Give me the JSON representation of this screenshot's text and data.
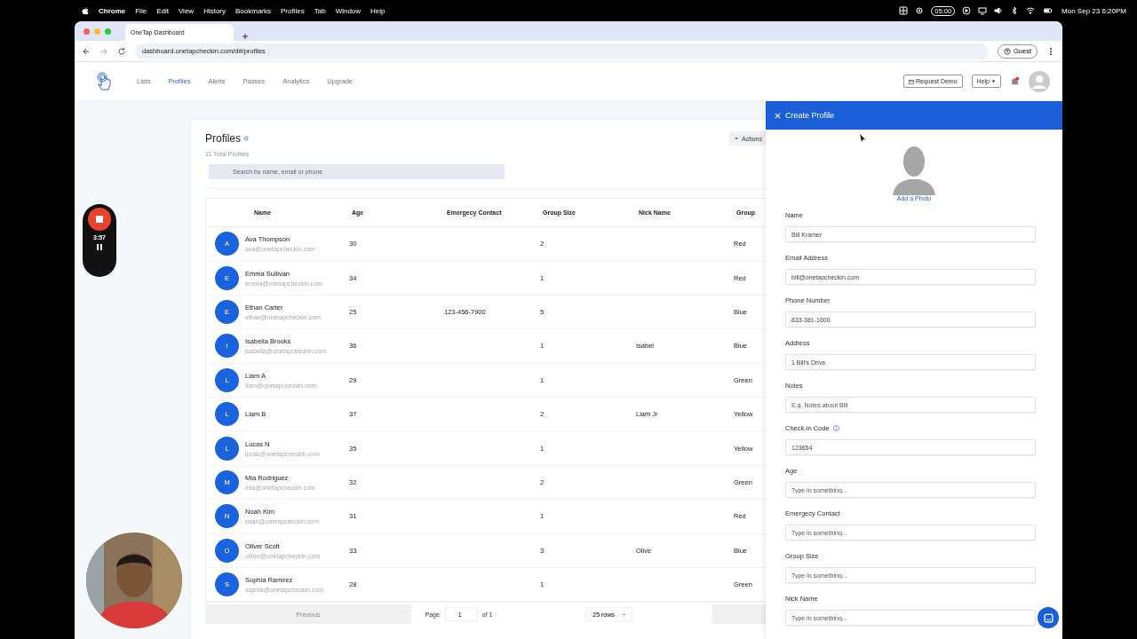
{
  "menu_bar": {
    "app": "Chrome",
    "menus": [
      "File",
      "Edit",
      "View",
      "History",
      "Bookmarks",
      "Profiles",
      "Tab",
      "Window",
      "Help"
    ],
    "timer": "05:00",
    "clock": "Mon Sep 23  6:20PM"
  },
  "browser": {
    "tab_title": "OneTap Dashboard",
    "url": "dashboard.onetapcheckin.com/d#/profiles",
    "profile_button": "Guest"
  },
  "nav": {
    "items": [
      {
        "label": "Lists",
        "selected": false
      },
      {
        "label": "Profiles",
        "selected": true
      },
      {
        "label": "Alerts",
        "selected": false
      },
      {
        "label": "Passes",
        "selected": false
      },
      {
        "label": "Analytics",
        "selected": false
      },
      {
        "label": "Upgrade",
        "selected": false
      }
    ],
    "request_demo": "Request Demo",
    "help": "Help"
  },
  "recorder": {
    "time": "3:57"
  },
  "profiles": {
    "title": "Profiles",
    "count": "11 Total Profiles",
    "search_placeholder": "Search by name, email or phone",
    "actions": "Actions",
    "columns": [
      "Name",
      "Age",
      "Emergecy Contact",
      "Group Size",
      "Nick Name",
      "Group"
    ],
    "rows": [
      {
        "initial": "A",
        "name": "Ava Thompson",
        "email": "ava@onetapcheckin.com",
        "age": "30",
        "emergency_contact": "",
        "group_size": "2",
        "nick_name": "",
        "group": "Red"
      },
      {
        "initial": "E",
        "name": "Emma Sullivan",
        "email": "emma@onetapcheckin.com",
        "age": "34",
        "emergency_contact": "",
        "group_size": "1",
        "nick_name": "",
        "group": "Red"
      },
      {
        "initial": "E",
        "name": "Ethan Carter",
        "email": "ethan@onetapcheckin.com",
        "age": "25",
        "emergency_contact": "123-456-7900",
        "group_size": "5",
        "nick_name": "",
        "group": "Blue"
      },
      {
        "initial": "I",
        "name": "Isabella Brooks",
        "email": "isabella@onetapcheckin.com",
        "age": "36",
        "emergency_contact": "",
        "group_size": "1",
        "nick_name": "Isabel",
        "group": "Blue"
      },
      {
        "initial": "L",
        "name": "Liam A",
        "email": "liam@onetapcheckin.com",
        "age": "29",
        "emergency_contact": "",
        "group_size": "1",
        "nick_name": "",
        "group": "Green"
      },
      {
        "initial": "L",
        "name": "Liam B",
        "email": "",
        "age": "37",
        "emergency_contact": "",
        "group_size": "2",
        "nick_name": "Liam Jr",
        "group": "Yellow"
      },
      {
        "initial": "L",
        "name": "Lucas N",
        "email": "lucas@onetapcheckin.com",
        "age": "35",
        "emergency_contact": "",
        "group_size": "1",
        "nick_name": "",
        "group": "Yellow"
      },
      {
        "initial": "M",
        "name": "Mia Rodriguez",
        "email": "mia@onetapcheckin.com",
        "age": "32",
        "emergency_contact": "",
        "group_size": "2",
        "nick_name": "",
        "group": "Green"
      },
      {
        "initial": "N",
        "name": "Noah Kim",
        "email": "noah@onetapcheckin.com",
        "age": "31",
        "emergency_contact": "",
        "group_size": "1",
        "nick_name": "",
        "group": "Red"
      },
      {
        "initial": "O",
        "name": "Oliver Scott",
        "email": "oliver@onetapcheckin.com",
        "age": "33",
        "emergency_contact": "",
        "group_size": "3",
        "nick_name": "Olive",
        "group": "Blue"
      },
      {
        "initial": "S",
        "name": "Sophia Ramirez",
        "email": "sophia@onetapcheckin.com",
        "age": "28",
        "emergency_contact": "",
        "group_size": "1",
        "nick_name": "",
        "group": "Green"
      }
    ],
    "pagination": {
      "previous": "Previous",
      "page_label": "Page",
      "page": "1",
      "of": "of 1",
      "rows": "25 rows"
    }
  },
  "drawer": {
    "title": "Create Profile",
    "add_photo": "Add a Photo",
    "fields": [
      {
        "label": "Name",
        "value": "Bill Kramer",
        "info": false
      },
      {
        "label": "Email Address",
        "value": "bill@onetapcheckin.com",
        "info": false
      },
      {
        "label": "Phone Number",
        "value": "833-381-1600",
        "info": false
      },
      {
        "label": "Address",
        "value": "1 Bill's Drive",
        "info": false
      },
      {
        "label": "Notes",
        "placeholder": "E.g. Notes about Bill",
        "info": false
      },
      {
        "label": "Check-in Code",
        "value": "123654",
        "info": true
      },
      {
        "label": "Age",
        "placeholder": "Type in something...",
        "info": false
      },
      {
        "label": "Emergecy Contact",
        "placeholder": "Type in something...",
        "info": false
      },
      {
        "label": "Group Size",
        "placeholder": "Type in something...",
        "info": false
      },
      {
        "label": "Nick Name",
        "placeholder": "Type in something...",
        "info": false
      }
    ]
  }
}
